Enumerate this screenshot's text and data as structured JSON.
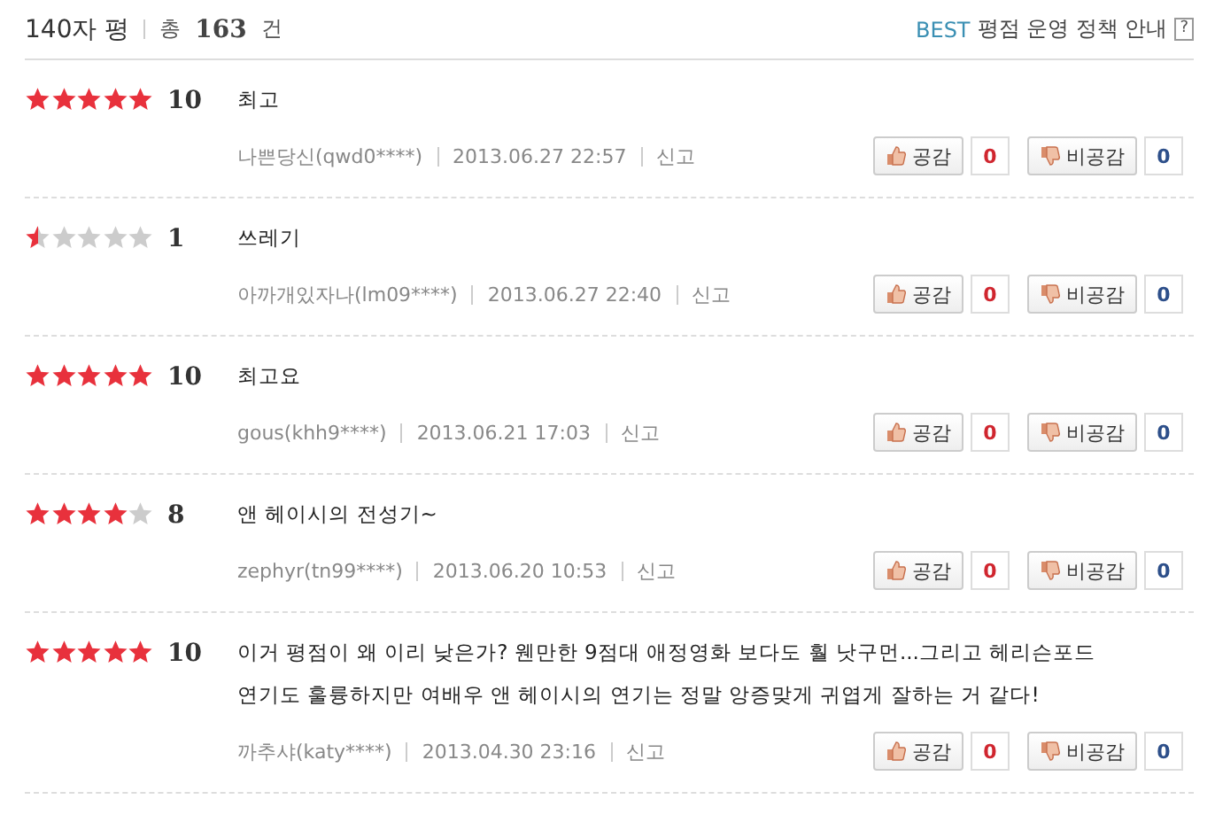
{
  "header": {
    "title": "140자 평",
    "total_label": "총",
    "total": "163",
    "total_unit": "건",
    "best_link": "BEST",
    "policy_link": "평점 운영 정책 안내",
    "help": "?"
  },
  "reviews": [
    {
      "stars": 5,
      "score": "10",
      "text": "최고",
      "author": "나쁜당신(qwd0****)",
      "date": "2013.06.27 22:57",
      "report": "신고",
      "like_label": "공감",
      "likes": "0",
      "dislike_label": "비공감",
      "dislikes": "0"
    },
    {
      "stars": 0.5,
      "score": "1",
      "text": "쓰레기",
      "author": "아까개있자나(lm09****)",
      "date": "2013.06.27 22:40",
      "report": "신고",
      "like_label": "공감",
      "likes": "0",
      "dislike_label": "비공감",
      "dislikes": "0"
    },
    {
      "stars": 5,
      "score": "10",
      "text": "최고요",
      "author": "gous(khh9****)",
      "date": "2013.06.21 17:03",
      "report": "신고",
      "like_label": "공감",
      "likes": "0",
      "dislike_label": "비공감",
      "dislikes": "0"
    },
    {
      "stars": 4,
      "score": "8",
      "text": "앤 헤이시의 전성기~",
      "author": "zephyr(tn99****)",
      "date": "2013.06.20 10:53",
      "report": "신고",
      "like_label": "공감",
      "likes": "0",
      "dislike_label": "비공감",
      "dislikes": "0"
    },
    {
      "stars": 5,
      "score": "10",
      "text": "이거 평점이 왜 이리 낮은가? 웬만한 9점대 애정영화 보다도 훨 낫구먼...그리고 헤리슨포드 연기도 훌륭하지만 여배우 앤 헤이시의 연기는 정말 앙증맞게 귀엽게 잘하는 거 같다!",
      "author": "까추샤(katy****)",
      "date": "2013.04.30 23:16",
      "report": "신고",
      "like_label": "공감",
      "likes": "0",
      "dislike_label": "비공감",
      "dislikes": "0"
    }
  ]
}
